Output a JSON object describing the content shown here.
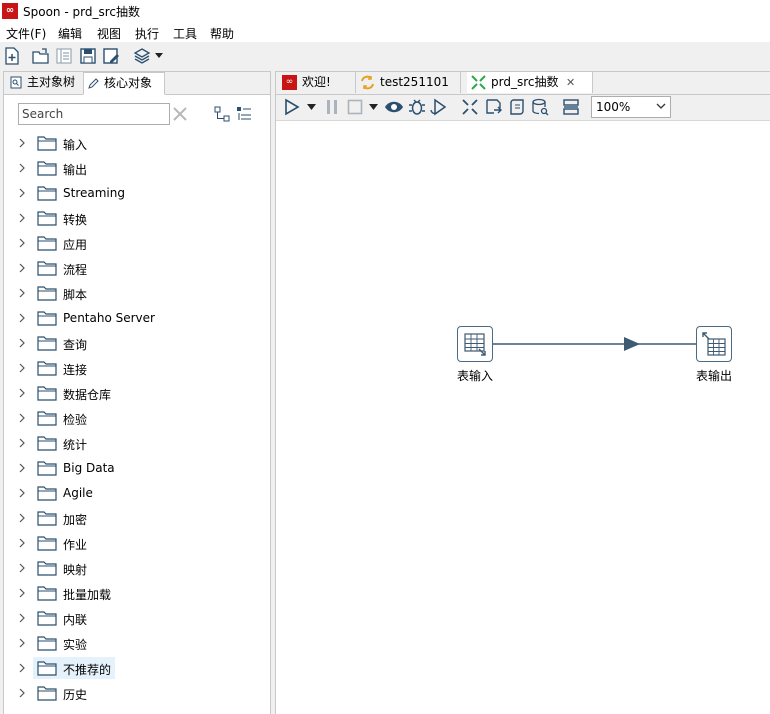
{
  "window": {
    "title": "Spoon - prd_src抽数",
    "app_icon_text": "∞"
  },
  "menu": [
    "文件(F)",
    "编辑",
    "视图",
    "执行",
    "工具",
    "帮助"
  ],
  "main_toolbar": {
    "icons": [
      "new-file-icon",
      "open-folder-icon",
      "explore-repository-icon",
      "save-icon",
      "save-as-icon",
      "layers-icon"
    ]
  },
  "left_panel": {
    "tabs": [
      {
        "label": "主对象树",
        "icon": "object-tree-icon",
        "active": false
      },
      {
        "label": "核心对象",
        "icon": "pencil-icon",
        "active": true
      }
    ],
    "search": {
      "placeholder": "Search",
      "value": ""
    },
    "tree": [
      "输入",
      "输出",
      "Streaming",
      "转换",
      "应用",
      "流程",
      "脚本",
      "Pentaho Server",
      "查询",
      "连接",
      "数据仓库",
      "检验",
      "统计",
      "Big Data",
      "Agile",
      "加密",
      "作业",
      "映射",
      "批量加载",
      "内联",
      "实验",
      "不推荐的",
      "历史"
    ],
    "highlighted_item": "不推荐的"
  },
  "editor": {
    "tabs": [
      {
        "label": "欢迎!",
        "icon": "welcome-icon",
        "active": false,
        "closable": false
      },
      {
        "label": "test251101",
        "icon": "job-icon",
        "active": false,
        "closable": false
      },
      {
        "label": "prd_src抽数",
        "icon": "transformation-icon",
        "active": true,
        "closable": true
      }
    ],
    "toolbar": {
      "icons": [
        "run-icon",
        "pause-icon",
        "stop-icon",
        "preview-icon",
        "debug-icon",
        "replay-icon",
        "verify-icon",
        "impact-icon",
        "sql-icon",
        "explore-db-icon",
        "show-results-icon"
      ],
      "zoom": "100%"
    }
  },
  "canvas": {
    "steps": [
      {
        "name": "表输入",
        "type": "table-input"
      },
      {
        "name": "表输出",
        "type": "table-output"
      }
    ],
    "hops": [
      {
        "from": "表输入",
        "to": "表输出"
      }
    ]
  },
  "colors": {
    "title_icon_red": "#c81414",
    "hop_line": "#3d5a73",
    "selection": "#e5f1fb"
  }
}
